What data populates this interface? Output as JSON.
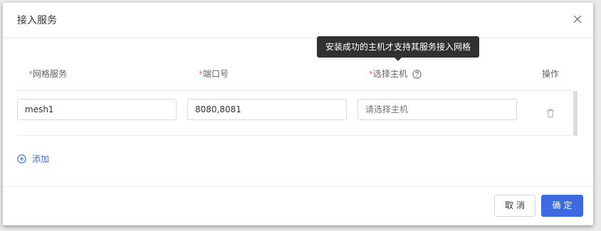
{
  "dialog": {
    "title": "接入服务",
    "tooltip": "安装成功的主机才支持其服务接入网格"
  },
  "table": {
    "required_mark": "*",
    "columns": {
      "mesh_service": "网格服务",
      "port": "端口号",
      "host": "选择主机",
      "actions": "操作"
    },
    "rows": [
      {
        "mesh_service": "mesh1",
        "port": "8080,8081",
        "host": "",
        "host_placeholder": "请选择主机"
      }
    ]
  },
  "add_label": "添加",
  "footer": {
    "cancel_label": "取消",
    "ok_label": "确定"
  },
  "colors": {
    "primary": "#3d6ae0",
    "required": "#f56c6c",
    "tooltip_bg": "#303133"
  },
  "icons": [
    "close-icon",
    "help-circle-icon",
    "trash-icon",
    "plus-circle-icon"
  ]
}
